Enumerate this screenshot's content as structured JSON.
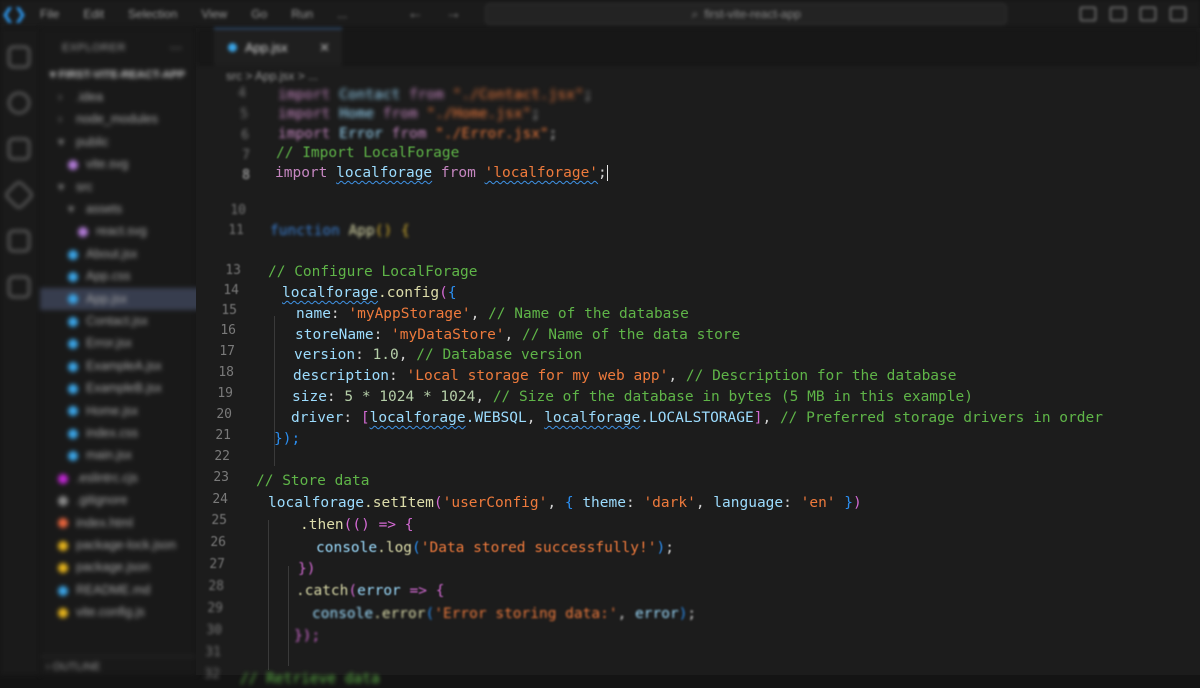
{
  "titlebar": {
    "menu": [
      "File",
      "Edit",
      "Selection",
      "View",
      "Go",
      "Run",
      "..."
    ],
    "search_text": "first-vite-react-app"
  },
  "sidebar": {
    "title": "EXPLORER",
    "more": "...",
    "folder": "FIRST-VITE-REACT-APP",
    "items": [
      {
        "label": ".idea",
        "kind": "folder",
        "color": "#888888"
      },
      {
        "label": "node_modules",
        "kind": "folder",
        "color": "#888888"
      },
      {
        "label": "public",
        "kind": "folder-open",
        "color": "#888888"
      },
      {
        "label": "vite.svg",
        "kind": "file",
        "color": "#b07ad6"
      },
      {
        "label": "src",
        "kind": "folder-open",
        "color": "#888888"
      },
      {
        "label": "assets",
        "kind": "folder-open",
        "color": "#888888"
      },
      {
        "label": "react.svg",
        "kind": "file",
        "color": "#b07ad6"
      },
      {
        "label": "About.jsx",
        "kind": "file",
        "color": "#3aa4e6"
      },
      {
        "label": "App.css",
        "kind": "file",
        "color": "#3aa4e6"
      },
      {
        "label": "App.jsx",
        "kind": "file",
        "color": "#3aa4e6"
      },
      {
        "label": "Contact.jsx",
        "kind": "file",
        "color": "#3aa4e6"
      },
      {
        "label": "Error.jsx",
        "kind": "file",
        "color": "#3aa4e6"
      },
      {
        "label": "ExampleA.jsx",
        "kind": "file",
        "color": "#3aa4e6"
      },
      {
        "label": "ExampleB.jsx",
        "kind": "file",
        "color": "#3aa4e6"
      },
      {
        "label": "Home.jsx",
        "kind": "file",
        "color": "#3aa4e6"
      },
      {
        "label": "index.css",
        "kind": "file",
        "color": "#3aa4e6"
      },
      {
        "label": "main.jsx",
        "kind": "file",
        "color": "#3aa4e6"
      },
      {
        "label": ".eslintrc.cjs",
        "kind": "file",
        "color": "#c026d3"
      },
      {
        "label": ".gitignore",
        "kind": "file",
        "color": "#888888"
      },
      {
        "label": "index.html",
        "kind": "file",
        "color": "#e8643c"
      },
      {
        "label": "package-lock.json",
        "kind": "file",
        "color": "#e5b31b"
      },
      {
        "label": "package.json",
        "kind": "file",
        "color": "#e5b31b"
      },
      {
        "label": "README.md",
        "kind": "file",
        "color": "#3aa4e6"
      },
      {
        "label": "vite.config.js",
        "kind": "file",
        "color": "#e5b31b"
      }
    ],
    "selected_index": 9,
    "outline": "OUTLINE"
  },
  "editor": {
    "tab_label": "App.jsx",
    "tab_close": "✕",
    "breadcrumb": "src > App.jsx > ...",
    "line_numbers": [
      "4",
      "5",
      "6",
      "7",
      "8",
      "10",
      "11",
      "13",
      "14",
      "15",
      "16",
      "17",
      "18",
      "19",
      "20",
      "21",
      "22",
      "23",
      "24",
      "25",
      "26",
      "27",
      "28",
      "29",
      "30",
      "31",
      "32"
    ],
    "lines": {
      "l4_kw": "import",
      "l4_id": "Contact",
      "l4_from": "from",
      "l4_str": "\"./Contact.jsx\"",
      "l4_end": ";",
      "l5_kw": "import",
      "l5_id": "Home",
      "l5_from": "from",
      "l5_str": "\"./Home.jsx\"",
      "l5_end": ";",
      "l6_kw": "import",
      "l6_id": "Error",
      "l6_from": "from",
      "l6_str": "\"./Error.jsx\"",
      "l6_end": ";",
      "l7_cm": "// Import LocalForage",
      "l8_kw": "import",
      "l8_id": "localforage",
      "l8_from": "from",
      "l8_str": "'localforage'",
      "l8_end": ";",
      "l11_kw": "function",
      "l11_fn": "App",
      "l11_rest": "() {",
      "l13_cm": "// Configure LocalForage",
      "l14_obj": "localforage",
      "l14_fn": ".config",
      "l14_p": "(",
      "l14_b": "{",
      "l15_key": "name",
      "l15_str": "'myAppStorage'",
      "l15_cm": "// Name of the database",
      "l16_key": "storeName",
      "l16_str": "'myDataStore'",
      "l16_cm": "// Name of the data store",
      "l17_key": "version",
      "l17_num": "1.0",
      "l17_cm": "// Database version",
      "l18_key": "description",
      "l18_str": "'Local storage for my web app'",
      "l18_cm": "// Description for the database",
      "l19_key": "size",
      "l19_num": "5 * 1024 * 1024",
      "l19_cm": "// Size of the database in bytes (5 MB in this example)",
      "l20_key": "driver",
      "l20_a": "localforage",
      "l20_ac": ".WEBSQL",
      "l20_b": "localforage",
      "l20_bc": ".LOCALSTORAGE",
      "l20_cm": "// Preferred storage drivers in order",
      "l21": "});",
      "l23_cm": "// Store data",
      "l24_obj": "localforage",
      "l24_fn": ".setItem",
      "l24_str": "'userConfig'",
      "l24_k1": "theme",
      "l24_v1": "'dark'",
      "l24_k2": "language",
      "l24_v2": "'en'",
      "l25_fn": ".then",
      "l25_rest": "(() => {",
      "l26_obj": "console",
      "l26_fn": ".log",
      "l26_str": "'Data stored successfully!'",
      "l27": "})",
      "l28_fn": ".catch",
      "l28_var": "error",
      "l28_rest": " => {",
      "l29_obj": "console",
      "l29_fn": ".error",
      "l29_str": "'Error storing data:'",
      "l29_var": "error",
      "l30": "});",
      "l32_cm": "// Retrieve data"
    }
  }
}
